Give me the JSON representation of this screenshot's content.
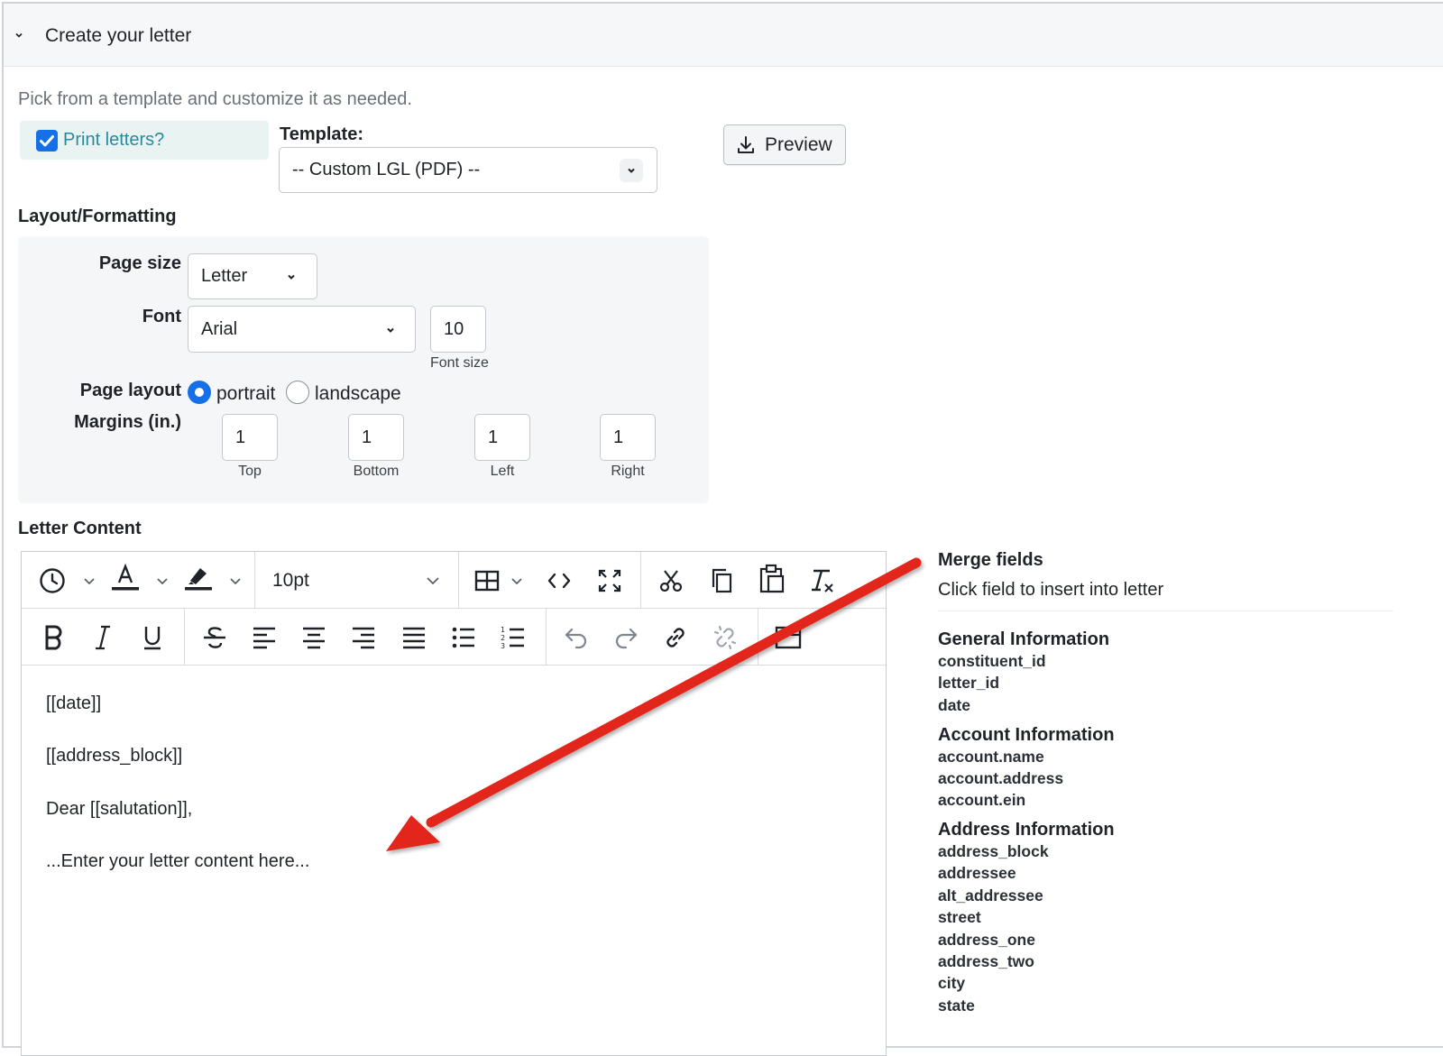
{
  "header": {
    "title": "Create your letter"
  },
  "subtitle": "Pick from a template and customize it as needed.",
  "print_letters": {
    "label": "Print letters?",
    "checked": true
  },
  "template": {
    "label": "Template:",
    "value": "-- Custom LGL (PDF) --"
  },
  "preview_button": {
    "label": "Preview",
    "icon": "download-icon"
  },
  "layout": {
    "heading": "Layout/Formatting",
    "page_size": {
      "label": "Page size",
      "value": "Letter"
    },
    "font": {
      "label": "Font",
      "value": "Arial",
      "size_value": "10",
      "size_caption": "Font size"
    },
    "page_layout": {
      "label": "Page layout",
      "selected": "portrait",
      "options": [
        "portrait",
        "landscape"
      ]
    },
    "margins": {
      "label": "Margins (in.)",
      "top": {
        "value": "1",
        "caption": "Top"
      },
      "bottom": {
        "value": "1",
        "caption": "Bottom"
      },
      "left": {
        "value": "1",
        "caption": "Left"
      },
      "right": {
        "value": "1",
        "caption": "Right"
      }
    }
  },
  "letter_content": {
    "heading": "Letter Content",
    "font_size": "10pt",
    "paragraphs": [
      "[[date]]",
      "[[address_block]]",
      "Dear [[salutation]],",
      "...Enter your letter content here..."
    ]
  },
  "merge_fields": {
    "title": "Merge fields",
    "subtitle": "Click field to insert into letter",
    "groups": [
      {
        "name": "General Information",
        "items": [
          "constituent_id",
          "letter_id",
          "date"
        ]
      },
      {
        "name": "Account Information",
        "items": [
          "account.name",
          "account.address",
          "account.ein"
        ]
      },
      {
        "name": "Address Information",
        "items": [
          "address_block",
          "addressee",
          "alt_addressee",
          "street",
          "address_one",
          "address_two",
          "city",
          "state"
        ]
      }
    ]
  },
  "colors": {
    "accent": "#1570e8",
    "arrow": "#e3261c",
    "teal": "#2a8a9c"
  }
}
